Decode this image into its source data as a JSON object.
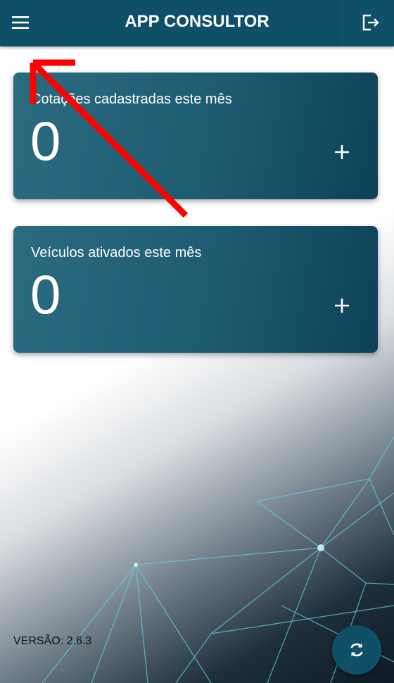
{
  "header": {
    "title": "APP CONSULTOR",
    "menu_icon": "menu-icon",
    "logout_icon": "logout-icon"
  },
  "cards": [
    {
      "label": "Cotações cadastradas este mês",
      "value": "0",
      "action_icon": "plus-icon"
    },
    {
      "label": "Veículos ativados este mês",
      "value": "0",
      "action_icon": "plus-icon"
    }
  ],
  "footer": {
    "version": "VERSÃO: 2.6.3",
    "refresh_icon": "refresh-icon"
  },
  "colors": {
    "primary": "#0f5068",
    "card_light": "#2b6b80",
    "card_dark": "#0d4257",
    "annotation_arrow": "#ff0000"
  }
}
